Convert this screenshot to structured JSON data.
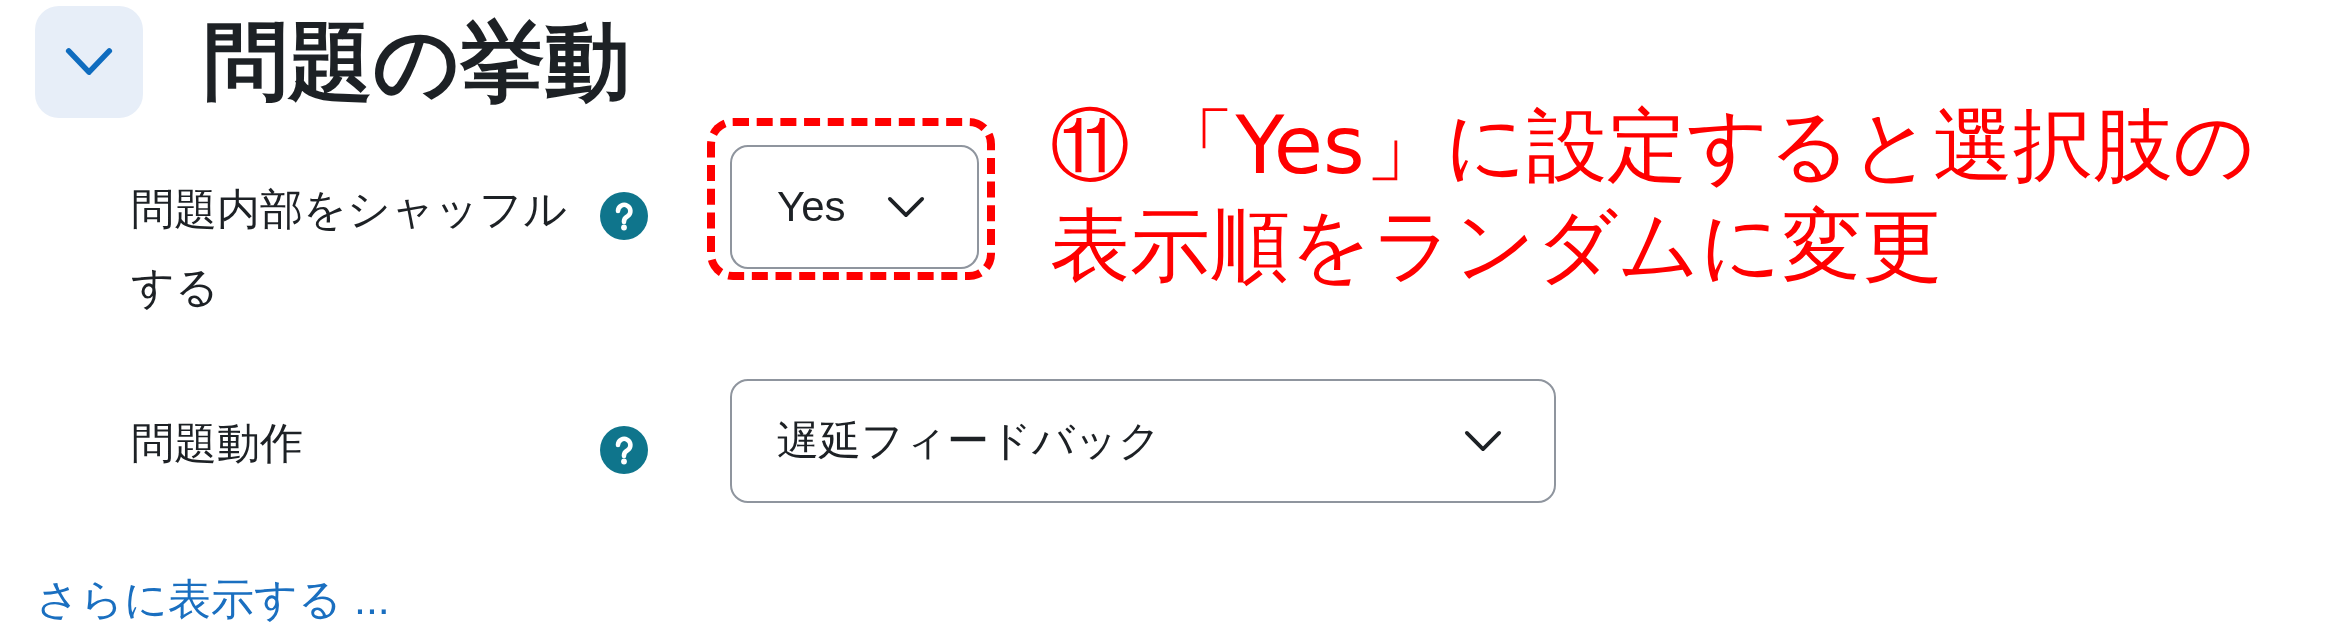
{
  "section": {
    "title": "問題の挙動",
    "expanded": true
  },
  "fields": [
    {
      "label": "問題内部をシャッフルする",
      "value": "Yes",
      "highlighted": true
    },
    {
      "label": "問題動作",
      "value": "遅延フィードバック",
      "highlighted": false
    }
  ],
  "show_more_link": "さらに表示する ...",
  "annotation": {
    "text": "⑪ 「Yes」に設定すると選択肢の表示順をランダムに変更"
  }
}
